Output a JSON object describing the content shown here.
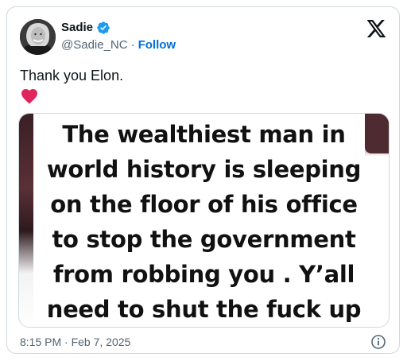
{
  "author": {
    "display_name": "Sadie",
    "handle": "@Sadie_NC",
    "separator": "·",
    "follow_label": "Follow",
    "verified": true,
    "verified_color": "#1d9bf0"
  },
  "tweet": {
    "text": "Thank you Elon.",
    "emoji": "heart-icon",
    "emoji_color": "#f91880"
  },
  "media": {
    "lines": [
      "The wealthiest man in",
      "world history is sleeping",
      "on the floor of his office",
      "to stop the government",
      "from robbing you . Y’all",
      "need to shut the fuck up"
    ]
  },
  "footer": {
    "timestamp": "8:15 PM · Feb 7, 2025"
  },
  "icons": {
    "brand": "x-logo-icon",
    "info": "info-icon"
  },
  "colors": {
    "text_primary": "#0f1419",
    "text_secondary": "#536471",
    "link": "#006fd6",
    "border": "#cfd9de"
  }
}
